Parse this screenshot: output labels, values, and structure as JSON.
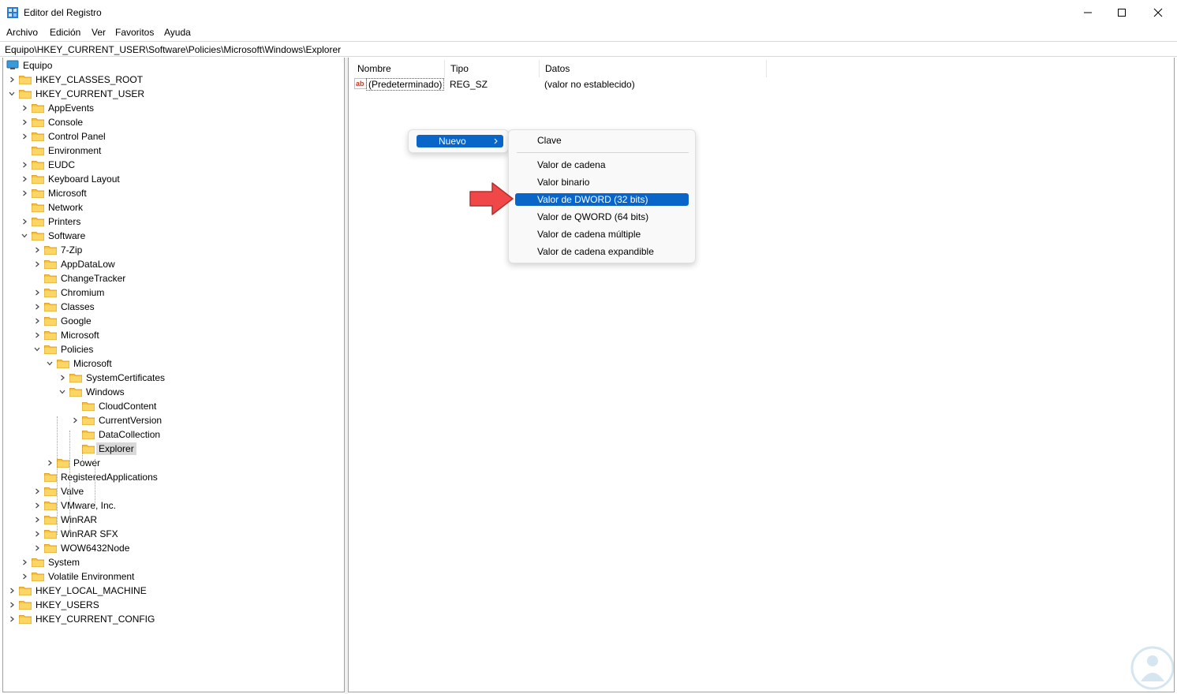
{
  "window": {
    "title": "Editor del Registro",
    "icon": "regedit-icon"
  },
  "menubar": [
    "Archivo",
    "Edición",
    "Ver",
    "Favoritos",
    "Ayuda"
  ],
  "address": "Equipo\\HKEY_CURRENT_USER\\Software\\Policies\\Microsoft\\Windows\\Explorer",
  "tree": {
    "root": "Equipo",
    "items": [
      "HKEY_CLASSES_ROOT",
      "HKEY_CURRENT_USER",
      "AppEvents",
      "Console",
      "Control Panel",
      "Environment",
      "EUDC",
      "Keyboard Layout",
      "Microsoft",
      "Network",
      "Printers",
      "Software",
      "7-Zip",
      "AppDataLow",
      "ChangeTracker",
      "Chromium",
      "Classes",
      "Google",
      "Microsoft",
      "Policies",
      "Microsoft",
      "SystemCertificates",
      "Windows",
      "CloudContent",
      "CurrentVersion",
      "DataCollection",
      "Explorer",
      "Power",
      "RegisteredApplications",
      "Valve",
      "VMware, Inc.",
      "WinRAR",
      "WinRAR SFX",
      "WOW6432Node",
      "System",
      "Volatile Environment",
      "HKEY_LOCAL_MACHINE",
      "HKEY_USERS",
      "HKEY_CURRENT_CONFIG"
    ],
    "selected": "Explorer"
  },
  "list": {
    "columns": [
      "Nombre",
      "Tipo",
      "Datos"
    ],
    "rows": [
      {
        "name": "(Predeterminado)",
        "type": "REG_SZ",
        "data": "(valor no establecido)"
      }
    ]
  },
  "context_menu": {
    "parent_label": "Nuevo",
    "submenu": [
      "Clave",
      "Valor de cadena",
      "Valor binario",
      "Valor de DWORD (32 bits)",
      "Valor de QWORD (64 bits)",
      "Valor de cadena múltiple",
      "Valor de cadena expandible"
    ],
    "highlighted": "Valor de DWORD (32 bits)",
    "highlight_color": "#0a65c9"
  },
  "annotation": {
    "arrow_color": "#f04848"
  }
}
